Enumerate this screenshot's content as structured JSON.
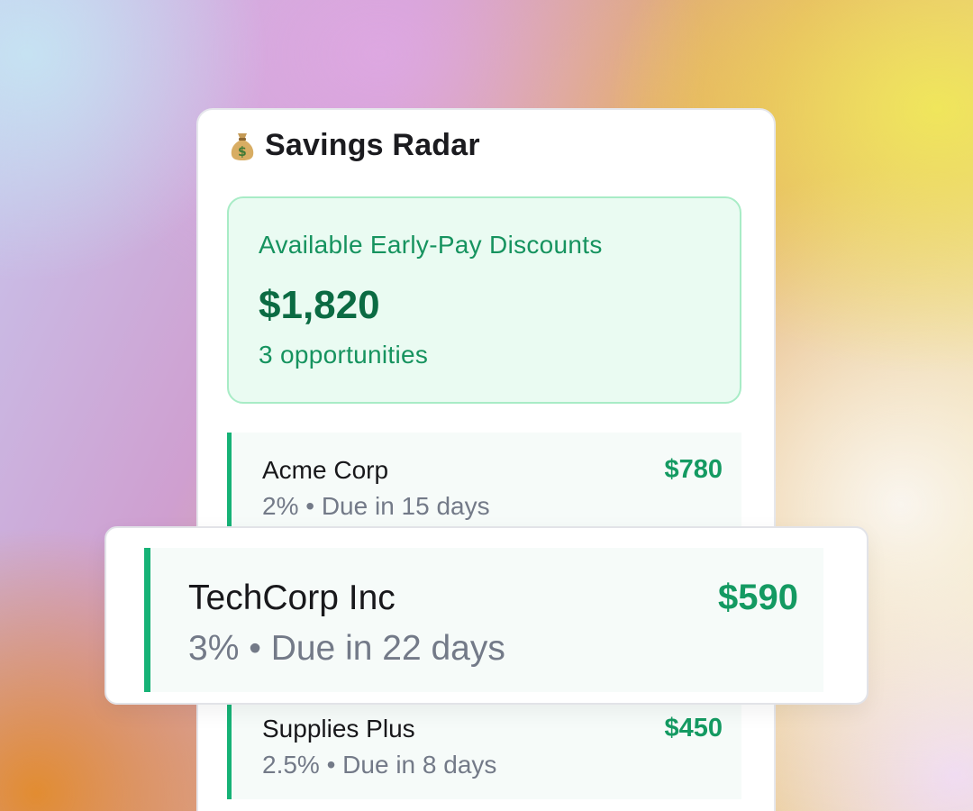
{
  "widget": {
    "icon": "money-bag-icon",
    "title": "Savings Radar"
  },
  "summary": {
    "label": "Available Early-Pay Discounts",
    "amount": "$1,820",
    "count": "3 opportunities"
  },
  "opportunities": [
    {
      "vendor": "Acme Corp",
      "meta": "2% • Due in 15 days",
      "amount": "$780"
    },
    {
      "vendor": "TechCorp Inc",
      "meta": "3% • Due in 22 days",
      "amount": "$590"
    },
    {
      "vendor": "Supplies Plus",
      "meta": "2.5% • Due in 8 days",
      "amount": "$450"
    }
  ],
  "colors": {
    "accent_green": "#16b276",
    "amount_green": "#149a62",
    "summary_bg": "#eafbf2",
    "summary_border": "#a8ecc6"
  }
}
